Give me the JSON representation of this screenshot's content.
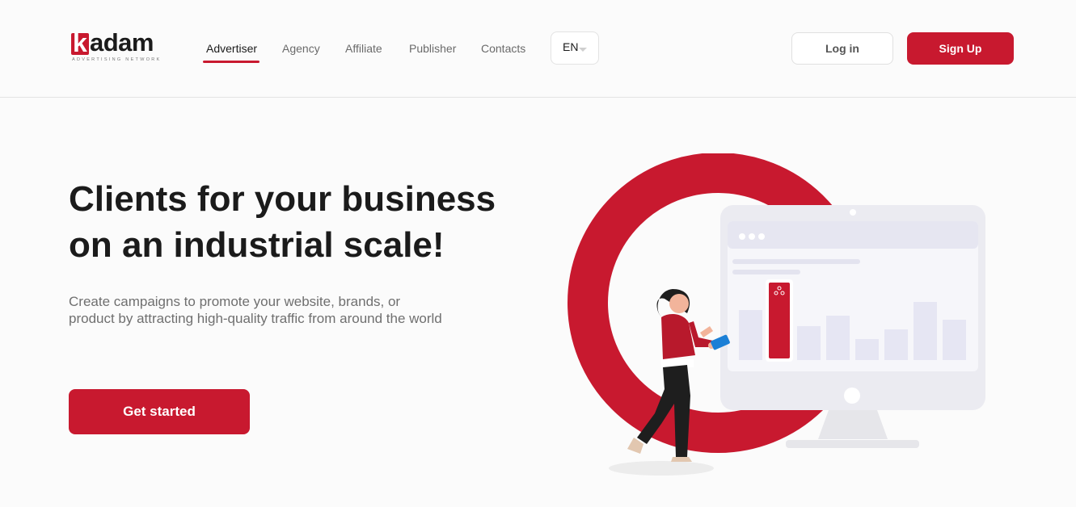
{
  "brand": {
    "logo_letter": "k",
    "logo_word": "adam",
    "tagline": "ADVERTISING NETWORK",
    "accent_color": "#c8192f"
  },
  "nav": {
    "items": [
      {
        "label": "Advertiser",
        "active": true
      },
      {
        "label": "Agency",
        "active": false
      },
      {
        "label": "Affiliate",
        "active": false
      },
      {
        "label": "Publisher",
        "active": false
      },
      {
        "label": "Contacts",
        "active": false
      }
    ]
  },
  "language": {
    "selected": "EN"
  },
  "auth": {
    "login_label": "Log in",
    "signup_label": "Sign Up"
  },
  "hero": {
    "title_line1": "Clients for your business",
    "title_line2": "on an industrial scale!",
    "subtitle": "Create campaigns to promote your website, brands, or product by attracting high-quality traffic from around the world",
    "cta_label": "Get started"
  },
  "illustration": {
    "icons": [
      "monitor-icon",
      "audience-icon",
      "tablet-icon"
    ],
    "bar_levels": [
      0.62,
      0.75,
      0.42,
      0.55,
      0.26,
      0.38,
      0.72,
      0.5
    ]
  }
}
